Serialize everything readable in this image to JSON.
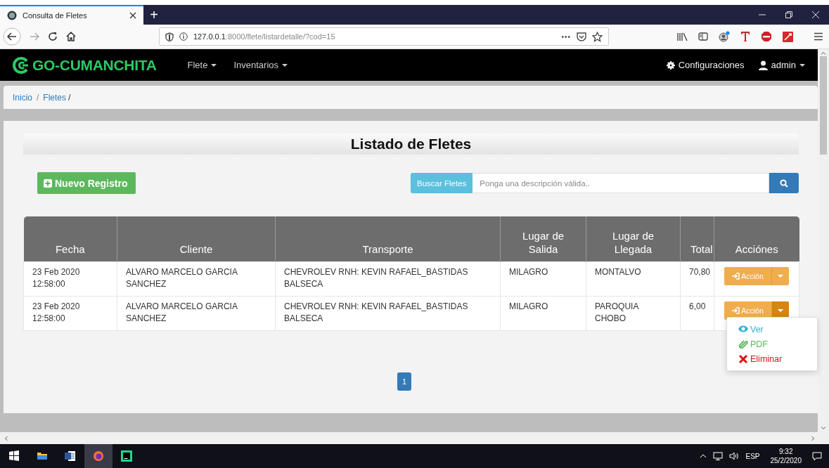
{
  "browser": {
    "tab": {
      "title": "Consulta de Fletes",
      "selected": true
    },
    "new_tab": "+",
    "url": {
      "host": "127.0.0.1",
      "rest": ":8000/flete/listardetalle/?cod=15"
    },
    "page_actions": "•••"
  },
  "navbar": {
    "brand": "GO-CUMANCHITA",
    "menus": [
      {
        "label": "Flete"
      },
      {
        "label": "Inventarios"
      }
    ],
    "settings": "Configuraciones",
    "user": "admin"
  },
  "breadcrumb": [
    {
      "label": "Inicio",
      "separator": "/"
    },
    {
      "label": "Fletes",
      "separator": "/"
    }
  ],
  "page_title": "Listado de Fletes",
  "new_button": "Nuevo Registro",
  "search": {
    "label": "Buscar Fletes",
    "placeholder": "Ponga una descripción válida.."
  },
  "table": {
    "columns": [
      "Fecha",
      "Cliente",
      "Transporte",
      "Lugar de Salida",
      "Lugar de Llegada",
      "Total",
      "Acciónes"
    ],
    "rows": [
      {
        "cells": [
          "23 Feb 2020 12:58:00",
          "ALVARO MARCELO GARCIA SANCHEZ",
          "CHEVROLEV RNH: KEVIN RAFAEL_BASTIDAS BALSECA",
          "MILAGRO",
          "MONTALVO",
          "70,80"
        ],
        "action": "Acción",
        "expanded": false
      },
      {
        "cells": [
          "23 Feb 2020 12:58:00",
          "ALVARO MARCELO GARCIA SANCHEZ",
          "CHEVROLEV RNH: KEVIN RAFAEL_BASTIDAS BALSECA",
          "MILAGRO",
          "PAROQUIA CHOBO",
          "6,00"
        ],
        "action": "Acción",
        "expanded": true
      }
    ]
  },
  "dropdown": [
    {
      "label": "Ver",
      "kind": "view"
    },
    {
      "label": "PDF",
      "kind": "pdf"
    },
    {
      "label": "Eliminar",
      "kind": "delete"
    }
  ],
  "pagination": [
    {
      "label": "1",
      "selected": true
    }
  ],
  "taskbar": {
    "language": "ESP",
    "time": "9:32",
    "date": "25/2/2020"
  }
}
